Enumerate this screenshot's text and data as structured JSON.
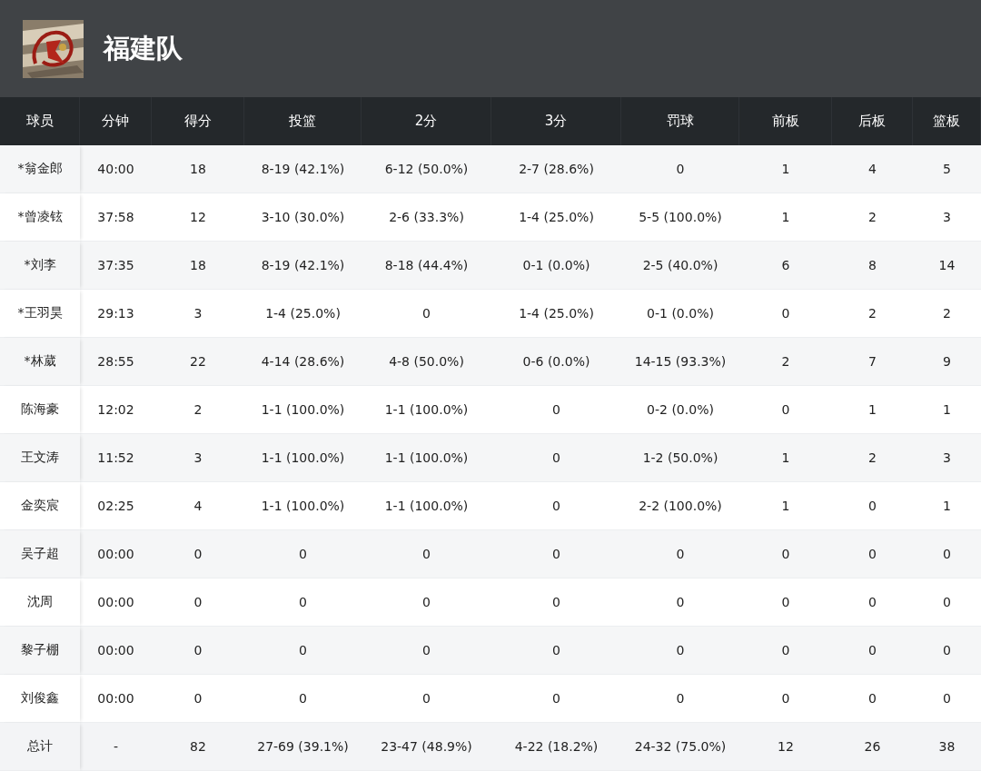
{
  "team": {
    "name": "福建队"
  },
  "table": {
    "columns": [
      "球员",
      "分钟",
      "得分",
      "投篮",
      "2分",
      "3分",
      "罚球",
      "前板",
      "后板",
      "篮板"
    ],
    "rows": [
      {
        "kind": "player",
        "cells": [
          "*翁金郎",
          "40:00",
          "18",
          "8-19 (42.1%)",
          "6-12 (50.0%)",
          "2-7 (28.6%)",
          "0",
          "1",
          "4",
          "5"
        ]
      },
      {
        "kind": "player",
        "cells": [
          "*曾凌铉",
          "37:58",
          "12",
          "3-10 (30.0%)",
          "2-6 (33.3%)",
          "1-4 (25.0%)",
          "5-5 (100.0%)",
          "1",
          "2",
          "3"
        ]
      },
      {
        "kind": "player",
        "cells": [
          "*刘李",
          "37:35",
          "18",
          "8-19 (42.1%)",
          "8-18 (44.4%)",
          "0-1 (0.0%)",
          "2-5 (40.0%)",
          "6",
          "8",
          "14"
        ]
      },
      {
        "kind": "player",
        "cells": [
          "*王羽昊",
          "29:13",
          "3",
          "1-4 (25.0%)",
          "0",
          "1-4 (25.0%)",
          "0-1 (0.0%)",
          "0",
          "2",
          "2"
        ]
      },
      {
        "kind": "player",
        "cells": [
          "*林葳",
          "28:55",
          "22",
          "4-14 (28.6%)",
          "4-8 (50.0%)",
          "0-6 (0.0%)",
          "14-15 (93.3%)",
          "2",
          "7",
          "9"
        ]
      },
      {
        "kind": "player",
        "cells": [
          "陈海豪",
          "12:02",
          "2",
          "1-1 (100.0%)",
          "1-1 (100.0%)",
          "0",
          "0-2 (0.0%)",
          "0",
          "1",
          "1"
        ]
      },
      {
        "kind": "player",
        "cells": [
          "王文涛",
          "11:52",
          "3",
          "1-1 (100.0%)",
          "1-1 (100.0%)",
          "0",
          "1-2 (50.0%)",
          "1",
          "2",
          "3"
        ]
      },
      {
        "kind": "player",
        "cells": [
          "金奕宸",
          "02:25",
          "4",
          "1-1 (100.0%)",
          "1-1 (100.0%)",
          "0",
          "2-2 (100.0%)",
          "1",
          "0",
          "1"
        ]
      },
      {
        "kind": "player",
        "cells": [
          "吴子超",
          "00:00",
          "0",
          "0",
          "0",
          "0",
          "0",
          "0",
          "0",
          "0"
        ]
      },
      {
        "kind": "player",
        "cells": [
          "沈周",
          "00:00",
          "0",
          "0",
          "0",
          "0",
          "0",
          "0",
          "0",
          "0"
        ]
      },
      {
        "kind": "player",
        "cells": [
          "黎子棚",
          "00:00",
          "0",
          "0",
          "0",
          "0",
          "0",
          "0",
          "0",
          "0"
        ]
      },
      {
        "kind": "player",
        "cells": [
          "刘俊鑫",
          "00:00",
          "0",
          "0",
          "0",
          "0",
          "0",
          "0",
          "0",
          "0"
        ]
      },
      {
        "kind": "total",
        "cells": [
          "总计",
          "-",
          "82",
          "27-69 (39.1%)",
          "23-47 (48.9%)",
          "4-22 (18.2%)",
          "24-32 (75.0%)",
          "12",
          "26",
          "38"
        ]
      }
    ]
  }
}
